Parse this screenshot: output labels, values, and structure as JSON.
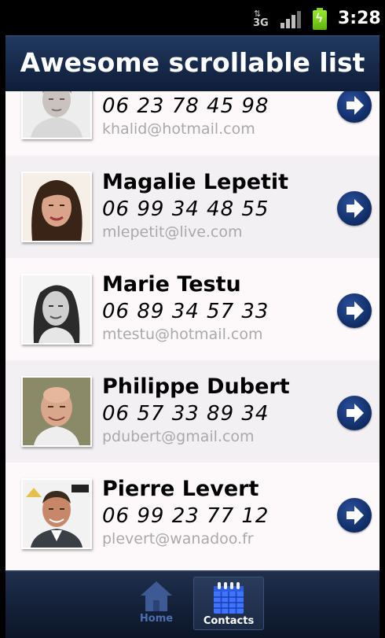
{
  "status_bar": {
    "network_type": "3G",
    "time": "3:28",
    "signal_level": 0.75,
    "battery_color": "#7dd11f"
  },
  "header": {
    "title": "Awesome scrollable list"
  },
  "contacts": [
    {
      "name": "",
      "phone": "06 23 78 45 98",
      "email": "khalid@hotmail.com",
      "avatar": "man-short-hair-photo"
    },
    {
      "name": "Magalie Lepetit",
      "phone": "06 99 34 48 55",
      "email": "mlepetit@live.com",
      "avatar": "woman-dark-hair-photo"
    },
    {
      "name": "Marie Testu",
      "phone": "06 89 34 57 33",
      "email": "mtestu@hotmail.com",
      "avatar": "woman-bw-photo"
    },
    {
      "name": "Philippe Dubert",
      "phone": "06 57 33 89 34",
      "email": "pdubert@gmail.com",
      "avatar": "bald-man-photo"
    },
    {
      "name": "Pierre Levert",
      "phone": "06 99 23 77 12",
      "email": "plevert@wanadoo.fr",
      "avatar": "man-suit-photo"
    }
  ],
  "row_action_icon": "arrow-right-circle-icon",
  "tabs": [
    {
      "label": "Home",
      "icon": "house-icon",
      "selected": false
    },
    {
      "label": "Contacts",
      "icon": "calendar-icon",
      "selected": true
    }
  ],
  "colors": {
    "header_bg": "#17294a",
    "action_button": "#12306b",
    "email_text": "#a9a9a9",
    "home_tab_text": "#4c6fb0"
  }
}
